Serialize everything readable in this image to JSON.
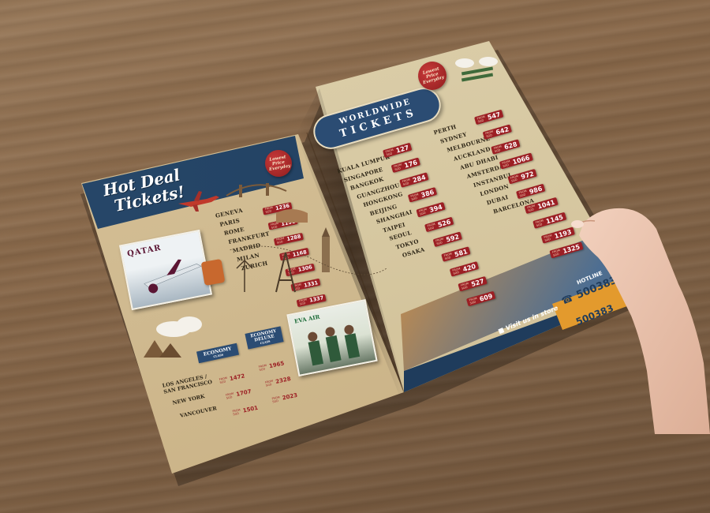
{
  "left_page": {
    "title_line1": "Hot Deal",
    "title_line2": "Tickets!",
    "seal_text": "Lowest Price Everyday",
    "cities": [
      "GENEVA",
      "PARIS",
      "ROME",
      "FRANKFURT",
      "MADRID",
      "MILAN",
      "ZURICH"
    ],
    "prices": [
      "1236",
      "1196",
      "1288",
      "1168",
      "1306",
      "1331",
      "1337"
    ],
    "airline_1": "QATAR",
    "airline_2": "EVA AIR",
    "class_economy": "ECONOMY",
    "class_deluxe": "ECONOMY DELUXE",
    "class_sub": "CLASS",
    "na_routes": [
      "LOS ANGELES / SAN FRANCISCO",
      "NEW YORK",
      "VANCOUVER"
    ],
    "economy_prices": [
      "1472",
      "1707",
      "1501"
    ],
    "deluxe_prices": [
      "1965",
      "2328",
      "2023"
    ]
  },
  "right_page": {
    "banner_line1": "WORLDWIDE",
    "banner_line2": "TICKETS",
    "seal_text": "Lowest Price Everyday",
    "col1_cities": [
      "KUALA LUMPUR",
      "SINGAPORE",
      "BANGKOK",
      "GUANGZHOU",
      "HONGKONG",
      "BEIJING",
      "SHANGHAI",
      "TAIPEI",
      "SEOUL",
      "TOKYO",
      "OSAKA"
    ],
    "col1_prices": [
      "127",
      "176",
      "284",
      "386",
      "394",
      "526",
      "592",
      "581",
      "420",
      "527",
      "609"
    ],
    "col2_cities": [
      "PERTH",
      "SYDNEY",
      "MELBOURNE",
      "AUCKLAND",
      "ABU DHABI",
      "AMSTERDAM",
      "INSTANBUL",
      "LONDON",
      "DUBAI",
      "BARCELONA"
    ],
    "col2_prices": [
      "547",
      "642",
      "628",
      "1066",
      "972",
      "986",
      "1041",
      "1145",
      "1193",
      "1325"
    ],
    "from_label": "FROM",
    "currency": "SGD",
    "visit_store": "Visit us in store",
    "hotline_label": "HOTLINE",
    "hotline_number": "500383"
  },
  "colors": {
    "navy": "#1f3c5c",
    "price_red": "#9c1f24",
    "orange": "#e39a2d",
    "paper": "#d6c7a0",
    "wood": "#8a6a4c"
  }
}
